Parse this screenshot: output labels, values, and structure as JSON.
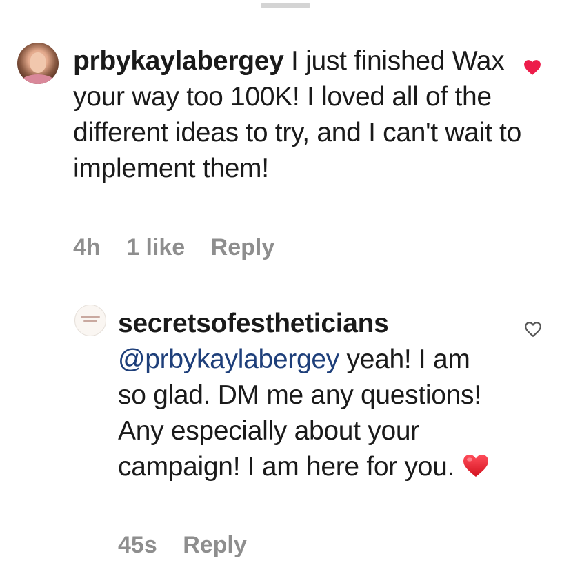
{
  "comments": [
    {
      "username": "prbykaylabergey",
      "text": " I just finished Wax your way too 100K! I loved all of the different ideas to try, and I can't wait to implement them!",
      "time": "4h",
      "likes": "1 like",
      "reply_label": "Reply",
      "liked": true,
      "like_color": "#ed1c4a"
    },
    {
      "username": "secretsofestheticians",
      "mention": "@prbykaylabergey",
      "text": " yeah! I am so glad. DM me any questions! Any especially about your campaign! I am here for you. ",
      "emoji": "red-heart",
      "time": "45s",
      "reply_label": "Reply",
      "liked": false
    }
  ],
  "colors": {
    "mention": "#1e3f7a",
    "meta": "#8e8e8e",
    "heart": "#ed1c4a"
  }
}
